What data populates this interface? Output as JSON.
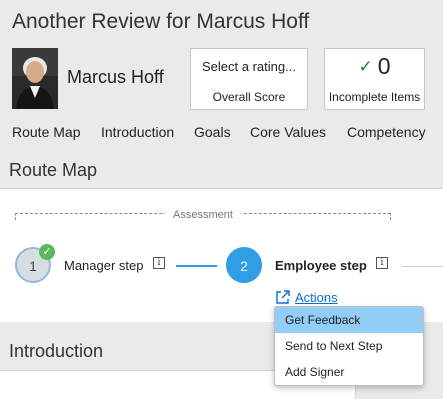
{
  "header": {
    "title": "Another Review for Marcus Hoff",
    "person_name": "Marcus Hoff"
  },
  "cards": {
    "rating": {
      "prompt": "Select a rating...",
      "label": "Overall Score"
    },
    "incomplete": {
      "icon": "checkmark-icon",
      "count": "0",
      "label": "Incomplete Items"
    }
  },
  "nav": [
    "Route Map",
    "Introduction",
    "Goals",
    "Core Values",
    "Competency"
  ],
  "route_map": {
    "heading": "Route Map",
    "group_label": "Assessment",
    "steps": [
      {
        "number": "1",
        "label": "Manager step",
        "status": "completed"
      },
      {
        "number": "2",
        "label": "Employee step",
        "status": "current"
      }
    ],
    "actions_label": "Actions"
  },
  "actions_menu": {
    "items": [
      "Get Feedback",
      "Send to Next Step",
      "Add Signer"
    ],
    "selected": "Get Feedback"
  },
  "introduction": {
    "heading": "Introduction"
  },
  "colors": {
    "accent": "#2f9ee6",
    "link": "#0a6ed1",
    "success": "#5cb85c",
    "menu_highlight": "#91cdf5"
  }
}
